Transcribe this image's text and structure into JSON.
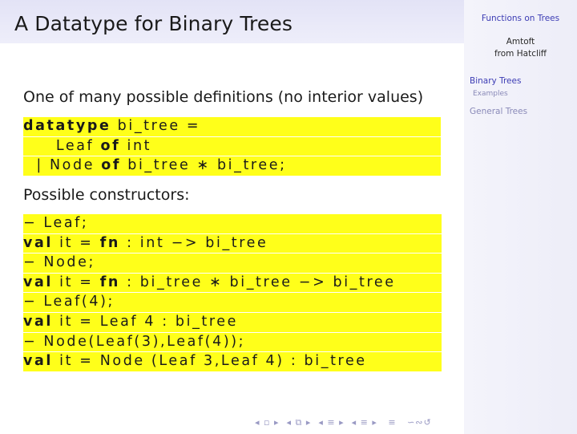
{
  "slide": {
    "title": "A Datatype for Binary Trees",
    "intro": "One of many possible definitions (no interior values)",
    "constructors_label": "Possible constructors:"
  },
  "code_def": [
    [
      {
        "t": "datatype",
        "kw": true
      },
      {
        "t": " bi_tree ="
      }
    ],
    [
      {
        "t": "     Leaf "
      },
      {
        "t": "of",
        "kw": true
      },
      {
        "t": " int"
      }
    ],
    [
      {
        "t": "  | Node "
      },
      {
        "t": "of",
        "kw": true
      },
      {
        "t": " bi_tree ∗ bi_tree;"
      }
    ]
  ],
  "code_session": [
    [
      {
        "t": "− Leaf;"
      }
    ],
    [
      {
        "t": "val",
        "kw": true
      },
      {
        "t": " it = "
      },
      {
        "t": "fn",
        "kw": true
      },
      {
        "t": " : int −> bi_tree"
      }
    ],
    [
      {
        "t": "− Node;"
      }
    ],
    [
      {
        "t": "val",
        "kw": true
      },
      {
        "t": " it = "
      },
      {
        "t": "fn",
        "kw": true
      },
      {
        "t": " : bi_tree ∗ bi_tree −> bi_tree"
      }
    ],
    [
      {
        "t": "− Leaf(4);"
      }
    ],
    [
      {
        "t": "val",
        "kw": true
      },
      {
        "t": " it = Leaf 4 : bi_tree"
      }
    ],
    [
      {
        "t": "− Node(Leaf(3),Leaf(4));"
      }
    ],
    [
      {
        "t": "val",
        "kw": true
      },
      {
        "t": " it = Node (Leaf 3,Leaf 4) : bi_tree"
      }
    ]
  ],
  "sidebar": {
    "header": "Functions on Trees",
    "author": "Amtoft",
    "source": "from Hatcliff",
    "sections": [
      {
        "label": "Binary Trees",
        "color": "#3c3cb4"
      },
      {
        "label": "Examples",
        "color": "#8a8ab8"
      },
      {
        "label": "General Trees",
        "color": "#8a8ab8"
      }
    ]
  },
  "nav": {
    "glyphs": "◂ ▫ ▸  ◂ ⧉ ▸  ◂ ≡ ▸  ◂ ≡ ▸   ≡   ∽∾↺"
  }
}
